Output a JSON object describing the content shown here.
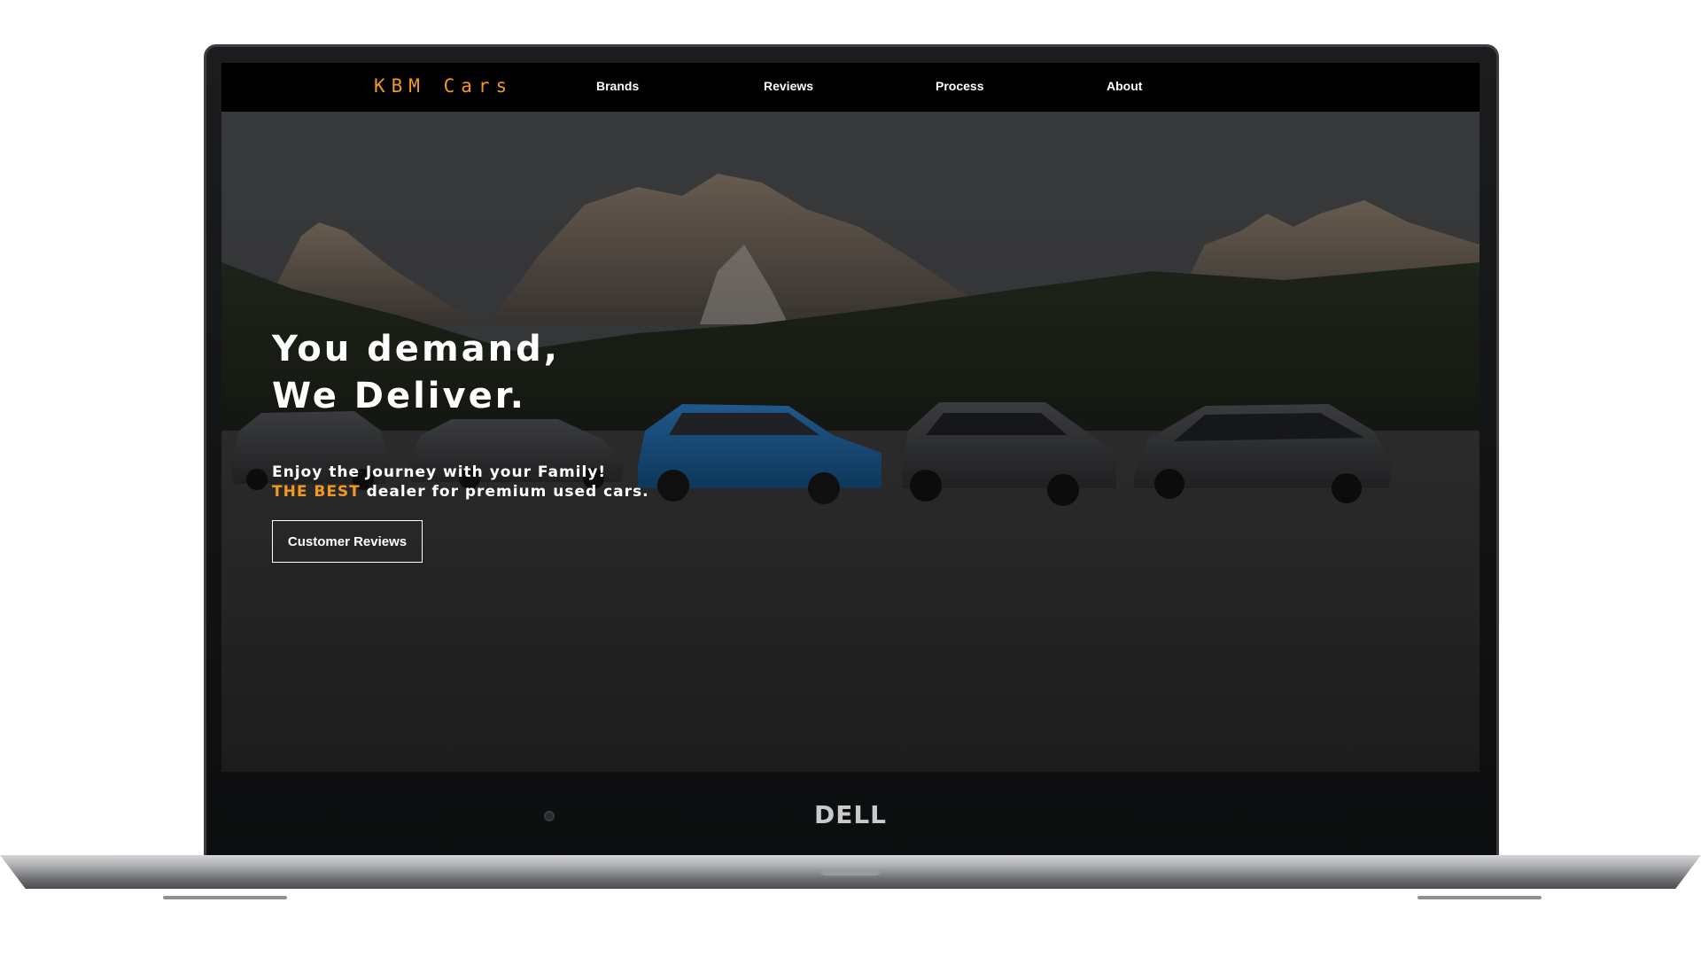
{
  "nav": {
    "brand": "KBM Cars",
    "links": [
      "Brands",
      "Reviews",
      "Process",
      "About"
    ]
  },
  "hero": {
    "headline_line1": "You demand,",
    "headline_line2": "We Deliver.",
    "tagline_line1": "Enjoy the Journey with your Family!",
    "tagline_accent": "THE BEST",
    "tagline_rest": " dealer for premium used cars.",
    "cta_label": "Customer Reviews"
  },
  "device": {
    "bezel_logo": "DELL"
  },
  "colors": {
    "accent": "#f29a1f",
    "nav_bg": "#000000",
    "text": "#ffffff"
  }
}
